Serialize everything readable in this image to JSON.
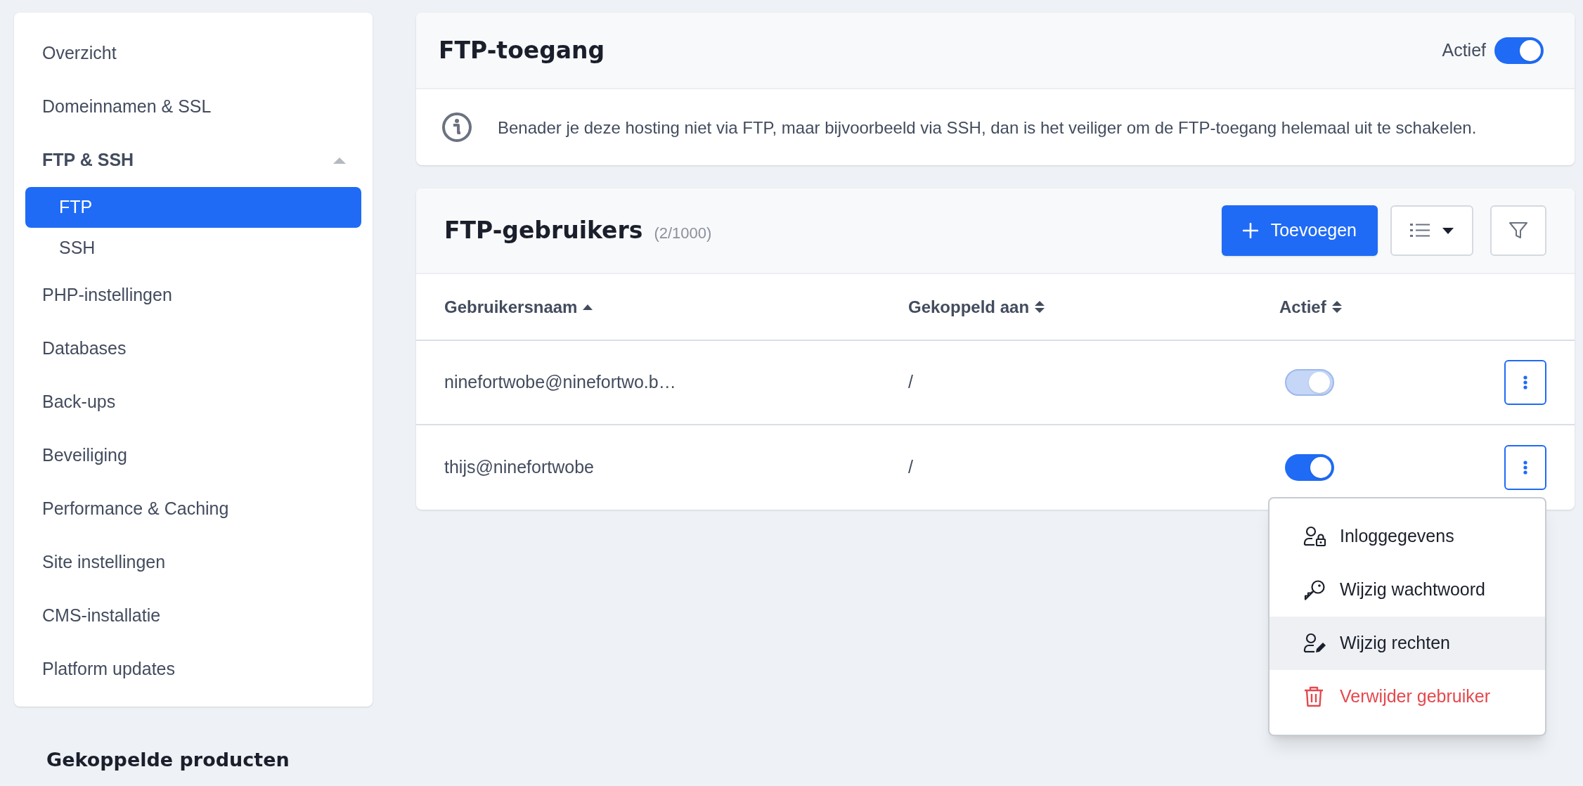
{
  "sidebar": {
    "items": [
      {
        "label": "Overzicht",
        "selected": false
      },
      {
        "label": "Domeinnamen & SSL",
        "selected": false
      },
      {
        "label": "FTP & SSH",
        "selected": false,
        "expanded": true,
        "children": [
          {
            "label": "FTP",
            "selected": true
          },
          {
            "label": "SSH",
            "selected": false
          }
        ]
      },
      {
        "label": "PHP-instellingen",
        "selected": false
      },
      {
        "label": "Databases",
        "selected": false
      },
      {
        "label": "Back-ups",
        "selected": false
      },
      {
        "label": "Beveiliging",
        "selected": false
      },
      {
        "label": "Performance & Caching",
        "selected": false
      },
      {
        "label": "Site instellingen",
        "selected": false
      },
      {
        "label": "CMS-installatie",
        "selected": false
      },
      {
        "label": "Platform updates",
        "selected": false
      }
    ],
    "linked_products_heading": "Gekoppelde producten"
  },
  "ftp_access": {
    "title": "FTP-toegang",
    "toggle_label": "Actief",
    "on": true,
    "info": "Benader je deze hosting niet via FTP, maar bijvoorbeeld via SSH, dan is het veiliger om de FTP-toegang helemaal uit te schakelen."
  },
  "ftp_users": {
    "title": "FTP-gebruikers",
    "count": "(2/1000)",
    "add_button": "Toevoegen",
    "columns": [
      {
        "label": "Gebruikersnaam",
        "sorted": true
      },
      {
        "label": "Gekoppeld aan",
        "sorted": false
      },
      {
        "label": "Actief",
        "sorted": false
      }
    ],
    "rows": [
      {
        "username": "ninefortwobe@ninefortwo.b…",
        "linked_to": "/",
        "active": true,
        "disabled": true
      },
      {
        "username": "thijs@ninefortwobe",
        "linked_to": "/",
        "active": true,
        "disabled": false
      }
    ]
  },
  "row_menu": {
    "items": [
      {
        "label": "Inloggegevens",
        "kind": "credentials",
        "highlighted": false
      },
      {
        "label": "Wijzig wachtwoord",
        "kind": "password",
        "highlighted": false
      },
      {
        "label": "Wijzig rechten",
        "kind": "permissions",
        "highlighted": true
      },
      {
        "label": "Verwijder gebruiker",
        "kind": "delete",
        "highlighted": false
      }
    ]
  }
}
